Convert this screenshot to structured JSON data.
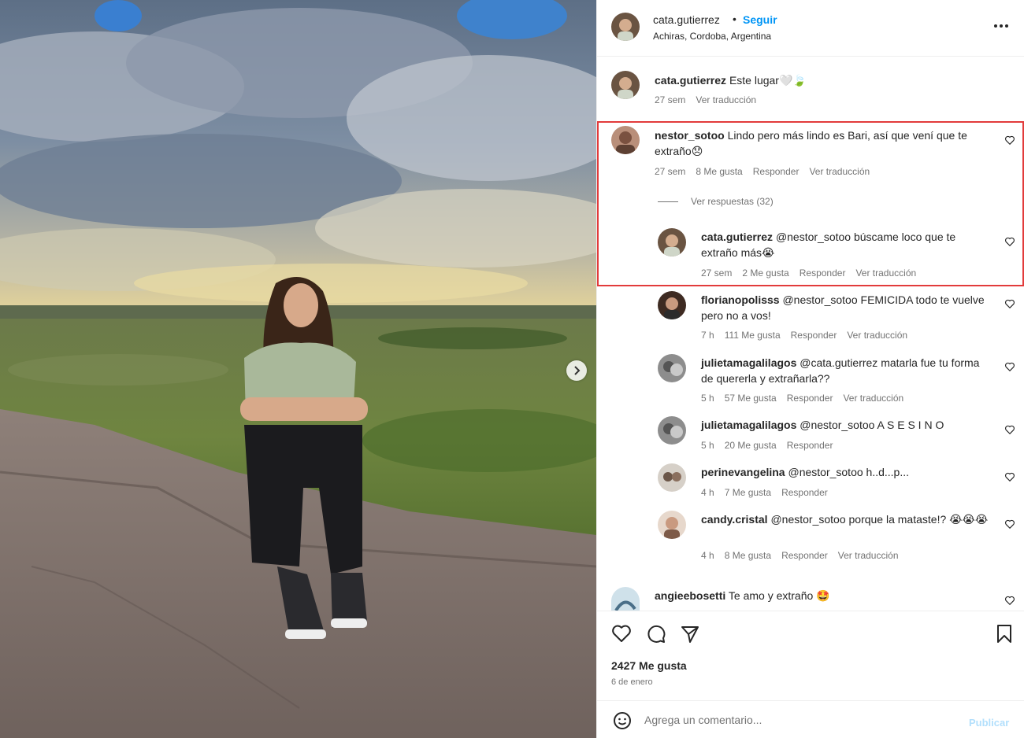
{
  "post": {
    "author": "cata.gutierrez",
    "follow_label": "Seguir",
    "separator": "•",
    "location": "Achiras, Cordoba, Argentina",
    "more_icon": "more-horizontal-icon"
  },
  "caption": {
    "user": "cata.gutierrez",
    "text": "Este lugar🤍🍃",
    "time": "27 sem",
    "translate": "Ver traducción"
  },
  "comments": [
    {
      "user": "nestor_sotoo",
      "text": "Lindo pero más lindo es Bari, así que vení que te extraño😞",
      "time": "27 sem",
      "likes": "8 Me gusta",
      "reply": "Responder",
      "translate": "Ver traducción",
      "view_replies": "Ver respuestas (32)"
    },
    {
      "user": "cata.gutierrez",
      "text": "@nestor_sotoo búscame loco que te extraño más😭",
      "time": "27 sem",
      "likes": "2 Me gusta",
      "reply": "Responder",
      "translate": "Ver traducción"
    },
    {
      "user": "florianopolisss",
      "text": "@nestor_sotoo FEMICIDA todo te vuelve pero no a vos!",
      "time": "7 h",
      "likes": "111 Me gusta",
      "reply": "Responder",
      "translate": "Ver traducción"
    },
    {
      "user": "julietamagalilagos",
      "text": "@cata.gutierrez matarla fue tu forma de quererla y extrañarla??",
      "time": "5 h",
      "likes": "57 Me gusta",
      "reply": "Responder",
      "translate": "Ver traducción"
    },
    {
      "user": "julietamagalilagos",
      "text": "@nestor_sotoo A S E S I N O",
      "time": "5 h",
      "likes": "20 Me gusta",
      "reply": "Responder"
    },
    {
      "user": "perinevangelina",
      "text": "@nestor_sotoo h..d...p...",
      "time": "4 h",
      "likes": "7 Me gusta",
      "reply": "Responder"
    },
    {
      "user": "candy.cristal",
      "text": "@nestor_sotoo porque la mataste!? 😭😭😭",
      "time": "4 h",
      "likes": "8 Me gusta",
      "reply": "Responder",
      "translate": "Ver traducción"
    },
    {
      "user": "angieebosetti",
      "text": "Te amo y extraño 🤩"
    }
  ],
  "footer": {
    "likes": "2427 Me gusta",
    "date": "6 de enero",
    "comment_placeholder": "Agrega un comentario...",
    "publish": "Publicar"
  },
  "colors": {
    "accent": "#0095f6",
    "highlight": "#e23b3b",
    "muted": "#737373"
  }
}
